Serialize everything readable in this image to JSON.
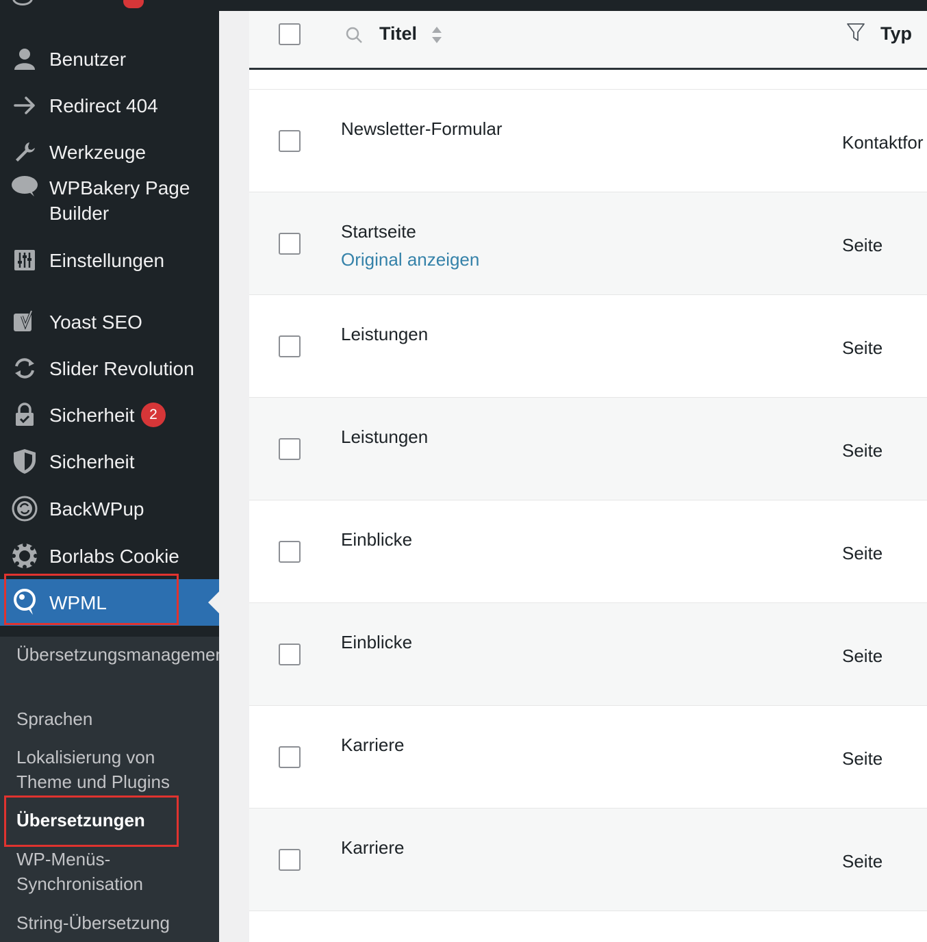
{
  "sidebar": {
    "items": [
      {
        "label": "Benutzer",
        "icon": "user-icon"
      },
      {
        "label": "Redirect 404",
        "icon": "arrow-right-icon"
      },
      {
        "label": "Werkzeuge",
        "icon": "wrench-icon"
      },
      {
        "label": "WPBakery Page Builder",
        "icon": "cloud-icon"
      },
      {
        "label": "Einstellungen",
        "icon": "settings-sliders-icon"
      },
      {
        "label": "Yoast SEO",
        "icon": "yoast-icon"
      },
      {
        "label": "Slider Revolution",
        "icon": "refresh-icon"
      },
      {
        "label": "Sicherheit",
        "icon": "lock-icon",
        "badge": "2"
      },
      {
        "label": "Sicherheit",
        "icon": "shield-icon"
      },
      {
        "label": "BackWPup",
        "icon": "backwpup-icon"
      },
      {
        "label": "Borlabs Cookie",
        "icon": "cookie-icon"
      },
      {
        "label": "WPML",
        "icon": "wpml-icon",
        "active": true
      }
    ],
    "submenu": [
      {
        "label": "Übersetzungsmanagement"
      },
      {
        "label": "Sprachen"
      },
      {
        "label": "Lokalisierung von Theme und Plugins"
      },
      {
        "label": "Übersetzungen",
        "current": true
      },
      {
        "label": "WP-Menüs-Synchronisation"
      },
      {
        "label": "String-Übersetzung"
      }
    ]
  },
  "table": {
    "columns": {
      "title": "Titel",
      "type": "Typ"
    },
    "rows": [
      {
        "title": "Newsletter-Formular",
        "type": "Kontaktfor"
      },
      {
        "title": "Startseite",
        "link": "Original anzeigen",
        "type": "Seite"
      },
      {
        "title": "Leistungen",
        "type": "Seite"
      },
      {
        "title": "Leistungen",
        "type": "Seite"
      },
      {
        "title": "Einblicke",
        "type": "Seite"
      },
      {
        "title": "Einblicke",
        "type": "Seite"
      },
      {
        "title": "Karriere",
        "type": "Seite"
      },
      {
        "title": "Karriere",
        "type": "Seite"
      }
    ]
  },
  "colors": {
    "sidebar_bg": "#1d2327",
    "active_bg": "#2c6fb0",
    "badge": "#d63638",
    "link": "#3582a9",
    "highlight": "#e0332f"
  }
}
